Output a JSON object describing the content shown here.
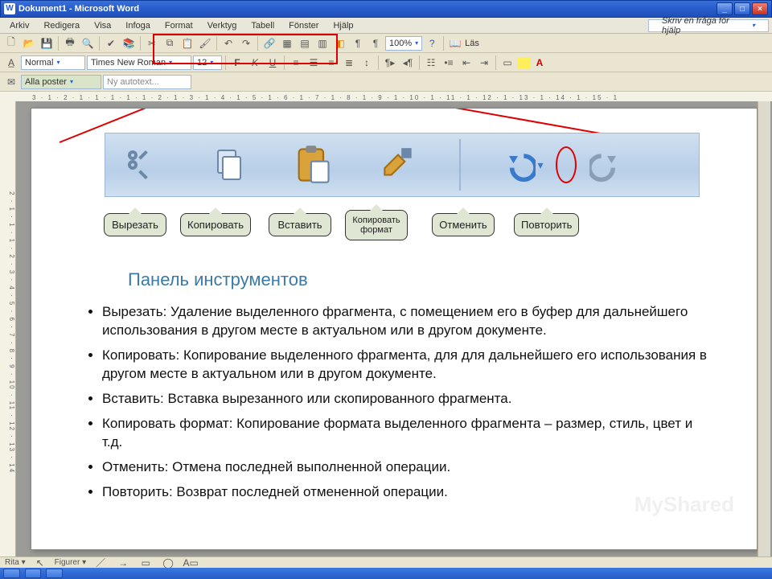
{
  "window": {
    "title": "Dokument1 - Microsoft Word"
  },
  "menu": {
    "items": [
      "Arkiv",
      "Redigera",
      "Visa",
      "Infoga",
      "Format",
      "Verktyg",
      "Tabell",
      "Fönster",
      "Hjälp"
    ],
    "help_placeholder": "Skriv en fråga för hjälp"
  },
  "toolbar_row1": {
    "zoom": "100%",
    "read_label": "Läs"
  },
  "toolbar_row2": {
    "style": "Normal",
    "font": "Times New Roman",
    "size": "12"
  },
  "toolbar_row3": {
    "posts_label": "Alla poster",
    "autotext_label": "Ny autotext..."
  },
  "ruler_h": "3 · 1 · 2 · 1 · 1 · 1 · 1 · 1 · 2 · 1 · 3 · 1 · 4 · 1 · 5 · 1 · 6 · 1 · 7 · 1 · 8 · 1 · 9 · 1 · 10 · 1 · 11 · 1 · 12 · 1 · 13 · 1 · 14 · 1 · 15 · 1",
  "ruler_v": "2 · 1 · 1 · 1 · 2 · 3 · 4 · 5 · 6 · 7 · 8 · 9 · 10 · 11 · 12 · 13 · 14",
  "callouts": {
    "cut": "Вырезать",
    "copy": "Копировать",
    "paste": "Вставить",
    "format_painter": "Копировать\nформат",
    "undo": "Отменить",
    "redo": "Повторить"
  },
  "doc": {
    "heading": "Панель инструментов",
    "bullets": [
      "Вырезать:  Удаление выделенного фрагмента, с помещением его в буфер для дальнейшего использования в другом месте в актуальном или в другом документе.",
      "Копировать: Копирование выделенного фрагмента, для для дальнейшего его использования в другом месте в актуальном или в другом документе.",
      "Вставить: Вставка вырезанного или скопированного фрагмента.",
      "Копировать формат: Копирование формата выделенного фрагмента – размер, стиль, цвет и т.д.",
      "Отменить: Отмена последней выполненной операции.",
      "Повторить: Возврат последней отмененной операции."
    ]
  },
  "status": {
    "draw_label": "Rita",
    "shapes_label": "Figurer"
  },
  "watermark": "MyShared"
}
